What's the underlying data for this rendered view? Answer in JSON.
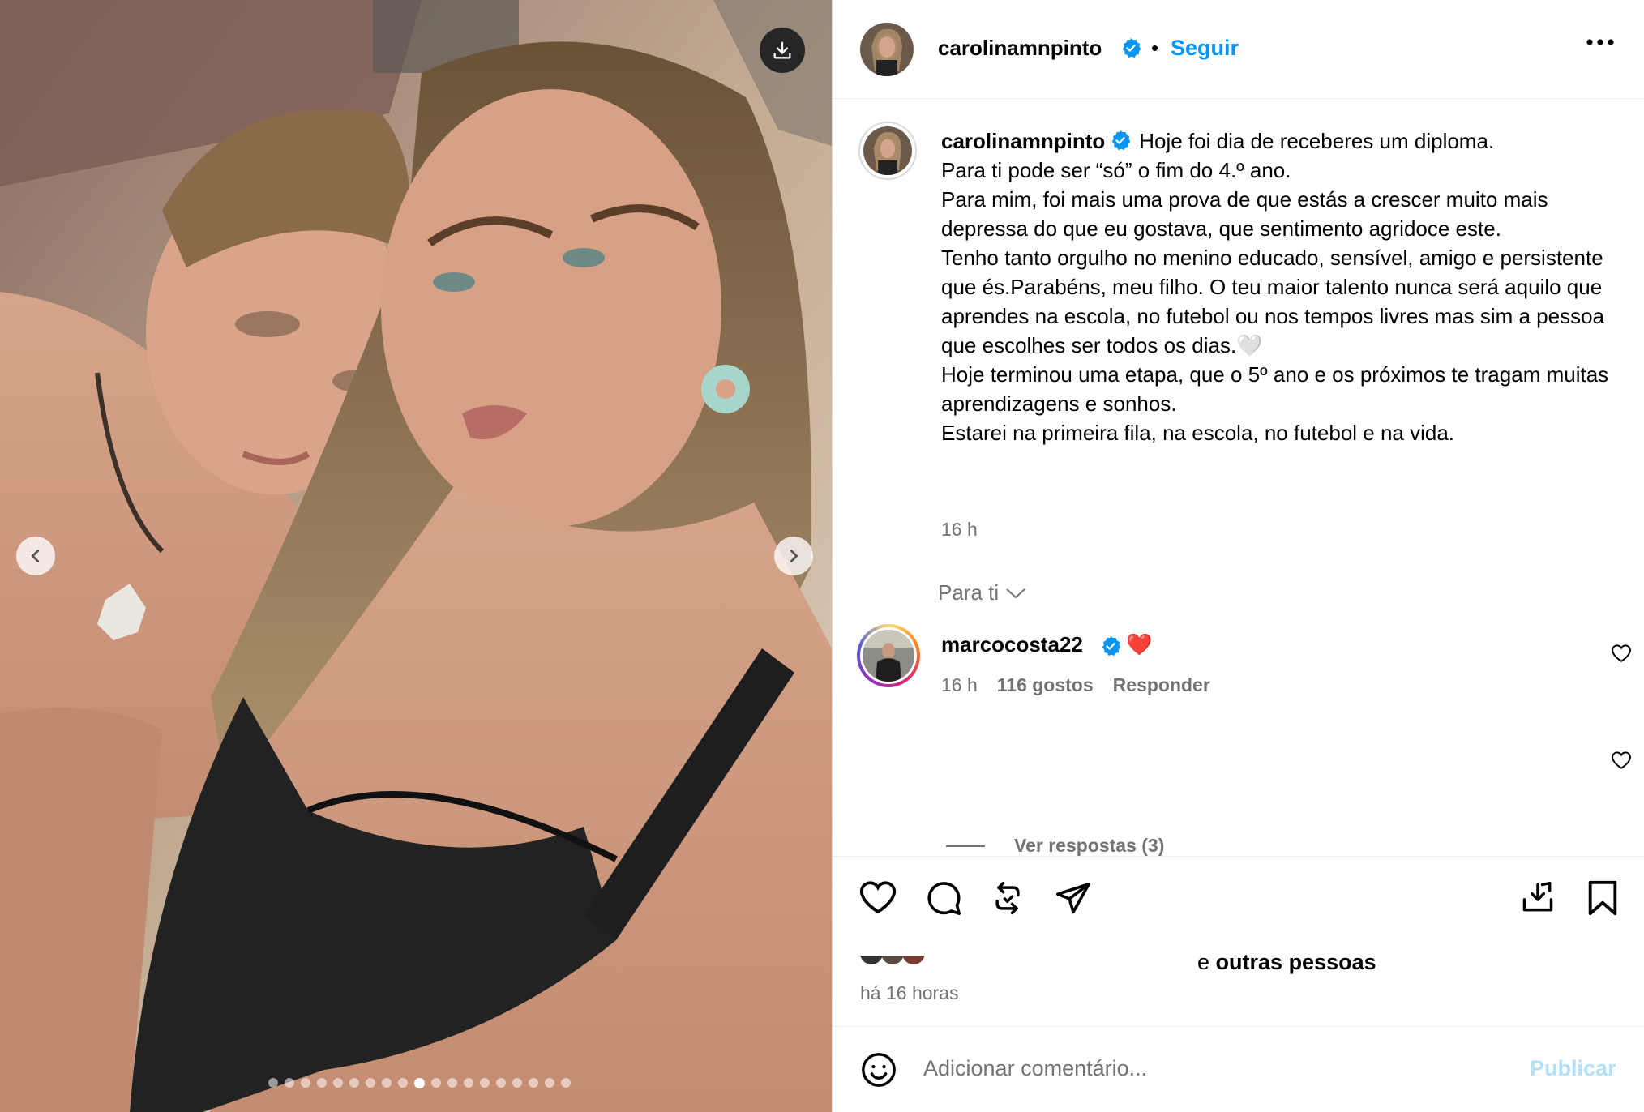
{
  "post": {
    "username": "carolinamnpinto",
    "follow_label": "Seguir",
    "separator": "•",
    "caption_lines": [
      "Hoje foi dia de receberes um diploma.",
      "Para ti pode ser “só” o fim do 4.º ano.",
      "Para mim, foi mais uma prova de que estás a crescer muito mais depressa do que eu gostava, que sentimento agridoce este.",
      "Tenho tanto orgulho no menino educado, sensível, amigo e persistente que és.Parabéns, meu filho. O teu maior talento nunca será aquilo que aprendes na escola, no futebol ou nos tempos livres mas sim a pessoa que escolhes ser todos os dias.🤍",
      "Hoje terminou uma etapa, que o 5º ano e os próximos te tragam muitas aprendizagens e sonhos.",
      "Estarei na primeira fila, na escola, no futebol e na vida."
    ],
    "caption_time": "16 h"
  },
  "media": {
    "total_slides": 19,
    "active_slide_index": 9,
    "icons": {
      "download": "download-icon",
      "prev": "chevron-left-icon",
      "next": "chevron-right-icon"
    }
  },
  "comments_filter": {
    "label": "Para ti"
  },
  "comment": {
    "username": "marcocosta22",
    "text": "❤️",
    "time": "16 h",
    "likes": "116 gostos",
    "reply_label": "Responder",
    "view_replies": "Ver respostas (3)"
  },
  "likes_summary": {
    "prefix": "e",
    "bold": "outras pessoas",
    "time_ago": "há 16 horas"
  },
  "composer": {
    "placeholder": "Adicionar comentário...",
    "publish_label": "Publicar"
  },
  "colors": {
    "accent": "#0095f6",
    "publish_disabled": "#b2dffc",
    "muted": "#737373",
    "verified": "#0095f6"
  }
}
